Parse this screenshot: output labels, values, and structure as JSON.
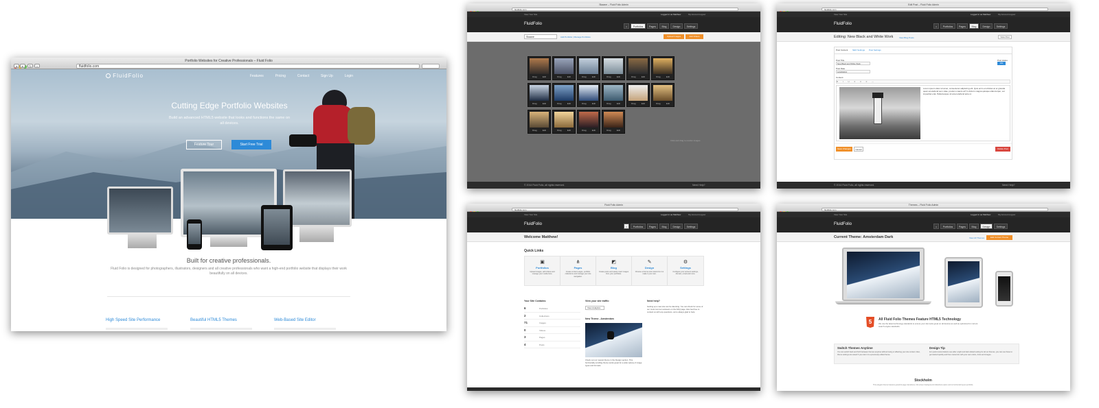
{
  "main": {
    "window_title": "Portfolio Websites for Creative Professionals – Fluid Folio",
    "url": "fluidfolio.com",
    "logo": "FluidFolio",
    "nav": [
      "Features",
      "Pricing",
      "Contact",
      "Sign Up",
      "Login"
    ],
    "hero_title": "Cutting Edge Portfolio Websites",
    "hero_sub": "Build an advanced HTML5 website that looks and functions the same on all devices.",
    "btn_tour": "Feature Tour",
    "btn_trial": "Start Free Trial",
    "built_title": "Built for creative professionals.",
    "built_sub": "Fluid Folio is designed for photographers, illustrators, designers and all creative professionals who want a high-end portfolio website that displays their work beautifully on all devices.",
    "features": [
      "High Speed Site Performance",
      "Beautiful HTML5 Themes",
      "Web-Based Site Editor"
    ]
  },
  "common": {
    "visit_site": "View Your Site",
    "logged_in": "Logged in as Matthew",
    "my_account": "My Account",
    "logout": "Logout",
    "menu": [
      "Portfolios",
      "Pages",
      "Blog",
      "Design",
      "Settings"
    ],
    "footer_left": "© 2014 Fluid Folio, all rights reserved.",
    "footer_right": "Need Help?",
    "logo": "FluidFolio"
  },
  "portfolio_win": {
    "title": "Skaane – Fluid Folio Admin",
    "select_value": "Skaane",
    "links": "Add Portfolio | Manage Portfolios",
    "btn_upload": "Upload Images",
    "btn_add_videos": "Add Videos",
    "thumb_drag": "Drag",
    "thumb_edit": "Edit",
    "footer_note": "Click and drag to reorder images"
  },
  "blog_win": {
    "title": "Edit Post – Fluid Folio Admin",
    "heading": "Editing: New Black and White Work",
    "view_link": "View Blog Posts",
    "view_post": "View Post",
    "tabs": [
      "Post Content",
      "SEO Settings",
      "Post Settings"
    ],
    "post_title_label": "Post Title",
    "post_title_value": "New Black and White Work",
    "post_date_label": "Post Date",
    "post_date_value": "12/18/2013",
    "post_status_label": "Post status",
    "post_status_value": "ON",
    "content_label": "Content",
    "body_text": "Lorem ipsum dolor sit amet, consectetur adipiscing elit. Quis enim et ultricies at et gravida quam at eleifend sem vitae, pretium mauris at? In dictum magna quisque ullamcorper, vel imperdiet erat. Pellentesque sit amet eleifend ante ut.",
    "btn_save": "Save Changes",
    "btn_cancel": "Cancel",
    "btn_delete": "Delete Post"
  },
  "dash_win": {
    "title": "Fluid Folio Admin",
    "welcome": "Welcome Matthew!",
    "quick_links_title": "Quick Links",
    "quick_links": [
      {
        "title": "Portfolios",
        "desc": "Upload images, add videos and manage your media here."
      },
      {
        "title": "Pages",
        "desc": "Create content pages, portfolio collections and manage your site navigation."
      },
      {
        "title": "Blog",
        "desc": "Create posts and easily insert images from your portfolios."
      },
      {
        "title": "Design",
        "desc": "Choose a theme and customize it to make it your own."
      },
      {
        "title": "Settings",
        "desc": "Configure your account settings, domain, email and more."
      }
    ],
    "contains_title": "Your Site Contains:",
    "stats": [
      {
        "n": "6",
        "label": "Portfolios"
      },
      {
        "n": "2",
        "label": "Collections"
      },
      {
        "n": "71",
        "label": "Images"
      },
      {
        "n": "0",
        "label": "Videos"
      },
      {
        "n": "3",
        "label": "Pages"
      },
      {
        "n": "4",
        "label": "Posts"
      }
    ],
    "traffic_title": "View your site traffic:",
    "traffic_btn": "View Analytics",
    "new_theme_title": "New Theme - Amsterdam",
    "new_theme_desc": "Check out our newest theme in the Design section. This horizontally scrolling theme works great for a wide variety of image types and formats.",
    "help_title": "Need help?",
    "help_desc": "Getting up a new site can be daunting. You can check for some of our most common answers on the FAQ page. Also feel free to contact us with any questions, we're always glad to help."
  },
  "theme_win": {
    "title": "Themes – Fluid Folio Admin",
    "heading": "Current Theme: Amsterdam Dark",
    "view_all": "View All Themes",
    "btn_edit": "Edit Current Theme",
    "html5_title": "All Fluid Folio Themes Feature HTML5 Technology",
    "html5_desc": "We use the latest technology standards to ensure your site looks great on all devices as well as optimized for current search engine standards.",
    "switch_title": "Switch Themes Anytime",
    "switch_desc": "You can switch back and forth between themes anytime without losing or affecting your site content. Also, theme settings are saved if you return to a previously edited theme.",
    "tip_title": "Design Tip",
    "tip_desc": "For quick customizations see after a light and dark default setting for all our themes, you can use these to get started quickly and then customize with your own colors, fonts and images.",
    "stockholm": "Stockholm",
    "stockholm_desc": "This elegant theme features graceful page transitions, full-screen background slideshow option and a horizontal layout portfolio."
  },
  "colors": {
    "accent": "#2d8ad8",
    "orange": "#f0902a",
    "dark": "#2b2b2b",
    "red": "#d9473f"
  }
}
